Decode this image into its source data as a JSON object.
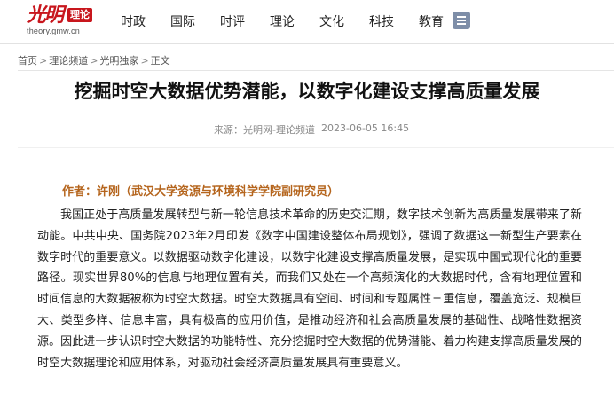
{
  "logo": {
    "mark": "光明",
    "badge": "理论",
    "url": "theory.gmw.cn"
  },
  "nav": {
    "items": [
      "时政",
      "国际",
      "时评",
      "理论",
      "文化",
      "科技",
      "教育"
    ]
  },
  "breadcrumb": {
    "items": [
      "首页",
      "理论频道",
      "光明独家",
      "正文"
    ],
    "separator": ">"
  },
  "article": {
    "title": "挖掘时空大数据优势潜能，以数字化建设支撑高质量发展",
    "source": "来源：光明网-理论频道",
    "time": "2023-06-05 16:45",
    "author": "作者：许刚（武汉大学资源与环境科学学院副研究员）",
    "paragraph": "我国正处于高质量发展转型与新一轮信息技术革命的历史交汇期，数字技术创新为高质量发展带来了新动能。中共中央、国务院2023年2月印发《数字中国建设整体布局规划》，强调了数据这一新型生产要素在数字时代的重要意义。以数据驱动数字化建设，以数字化建设支撑高质量发展，是实现中国式现代化的重要路径。现实世界80%的信息与地理位置有关，而我们又处在一个高频演化的大数据时代，含有地理位置和时间信息的大数据被称为时空大数据。时空大数据具有空间、时间和专题属性三重信息，覆盖宽泛、规模巨大、类型多样、信息丰富，具有极高的应用价值，是推动经济和社会高质量发展的基础性、战略性数据资源。因此进一步认识时空大数据的功能特性、充分挖掘时空大数据的优势潜能、着力构建支撑高质量发展的时空大数据理论和应用体系，对驱动社会经济高质量发展具有重要意义。"
  },
  "colors": {
    "brand": "#c8161d",
    "author": "#b5651d",
    "menu_icon": "#7e8ea8"
  }
}
